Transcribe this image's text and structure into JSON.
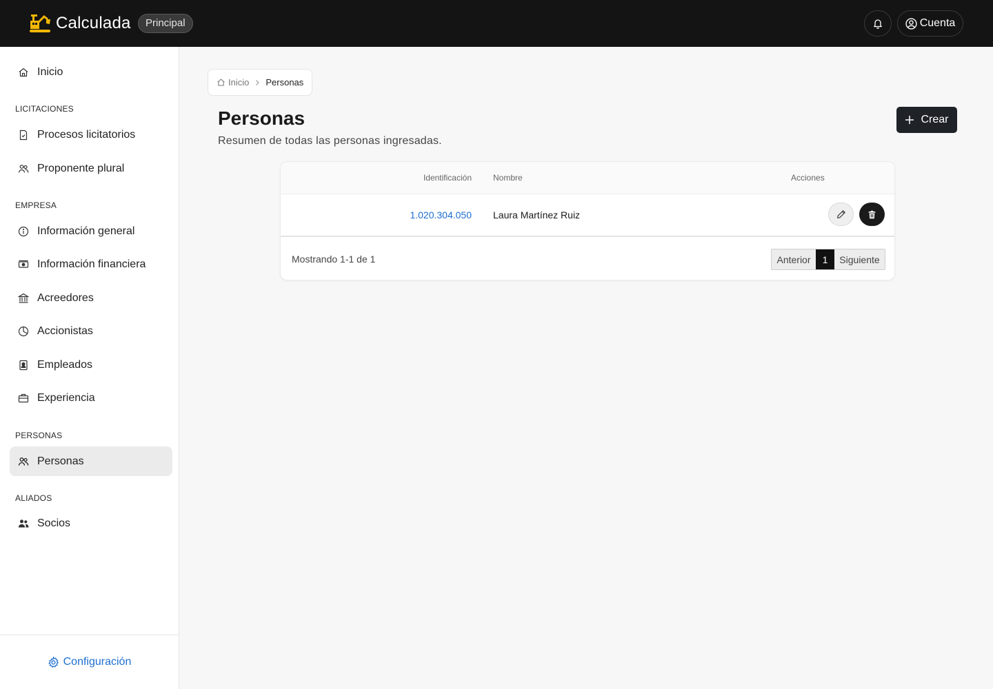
{
  "header": {
    "app_name": "Calculada",
    "env_badge": "Principal",
    "account_label": "Cuenta",
    "logo_color": "#f2b705"
  },
  "sidebar": {
    "home": "Inicio",
    "sections": [
      {
        "label": "LICITACIONES",
        "items": [
          "Procesos licitatorios",
          "Proponente plural"
        ]
      },
      {
        "label": "EMPRESA",
        "items": [
          "Información general",
          "Información financiera",
          "Acreedores",
          "Accionistas",
          "Empleados",
          "Experiencia"
        ]
      },
      {
        "label": "PERSONAS",
        "items": [
          "Personas"
        ]
      },
      {
        "label": "ALIADOS",
        "items": [
          "Socios"
        ]
      }
    ],
    "active_item": "Personas",
    "footer_label": "Configuración"
  },
  "breadcrumb": {
    "home": "Inicio",
    "current": "Personas"
  },
  "page": {
    "title": "Personas",
    "subtitle": "Resumen de todas las personas ingresadas.",
    "create_label": "Crear"
  },
  "table": {
    "columns": [
      "Identificación",
      "Nombre",
      "Acciones"
    ],
    "rows": [
      {
        "id": "1.020.304.050",
        "name": "Laura Martínez Ruiz"
      }
    ],
    "summary": "Mostrando 1-1 de 1",
    "pager": {
      "prev": "Anterior",
      "current": "1",
      "next": "Siguiente"
    }
  },
  "colors": {
    "accent_link": "#1e6fd0",
    "topbar_bg": "#141414",
    "primary_button": "#1f2328"
  }
}
